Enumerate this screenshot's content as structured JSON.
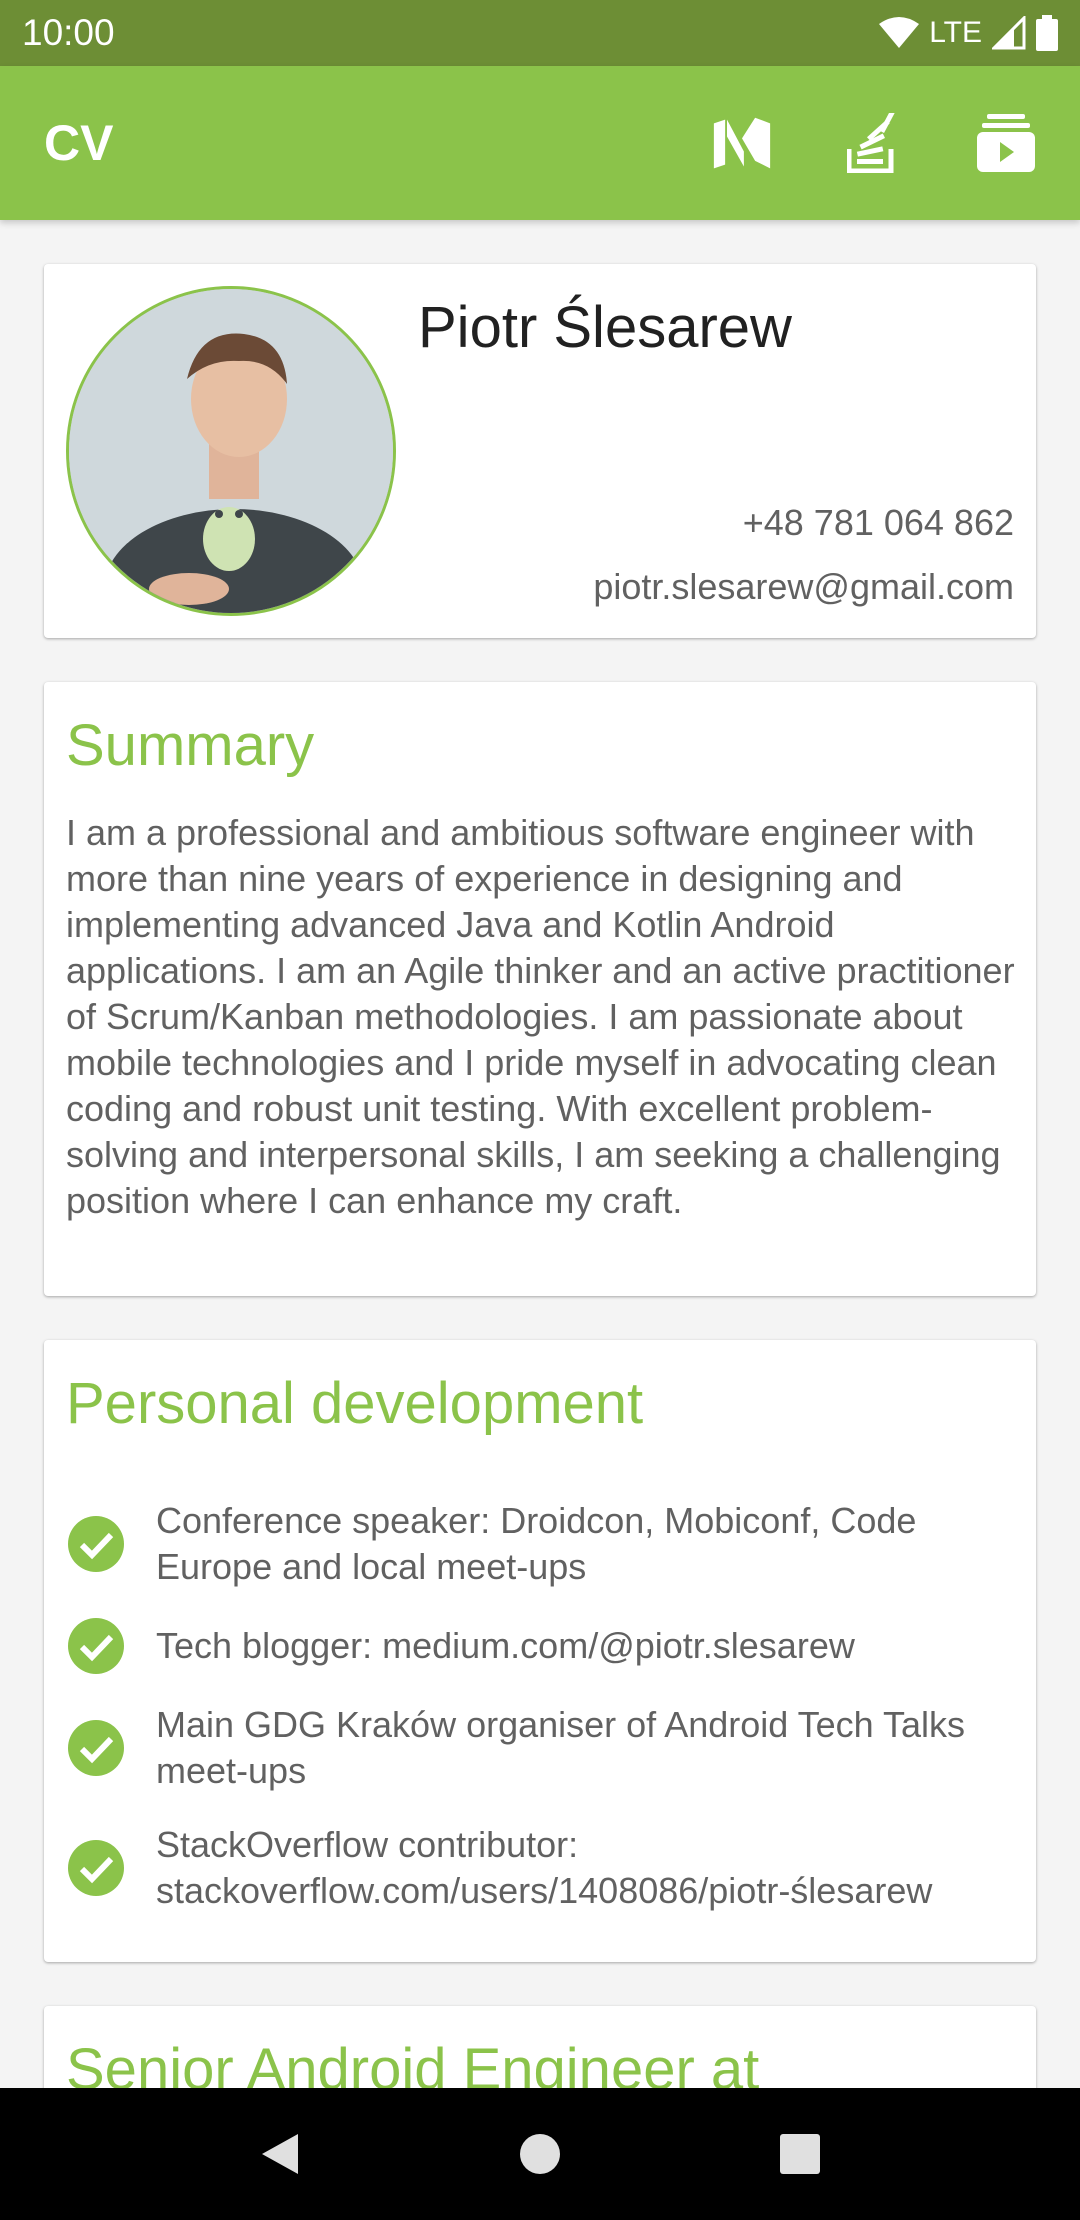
{
  "status_bar": {
    "time": "10:00",
    "network": "LTE"
  },
  "app_bar": {
    "title": "CV",
    "actions": [
      "medium-icon",
      "stackoverflow-icon",
      "youtube-icon"
    ]
  },
  "profile": {
    "name": "Piotr Ślesarew",
    "phone": "+48 781 064 862",
    "email": "piotr.slesarew@gmail.com"
  },
  "summary": {
    "heading": "Summary",
    "text": "I am a professional and ambitious software engineer with more than nine years of experience in designing and implementing advanced Java and Kotlin Android applications. I am an Agile thinker and an active practitioner of Scrum/Kanban methodologies. I am passionate about mobile technologies and I pride myself in advocating clean coding and robust unit testing. With excellent problem-solving and interpersonal skills, I am seeking a challenging position where I can enhance my craft."
  },
  "personal_development": {
    "heading": "Personal development",
    "items": [
      "Conference speaker: Droidcon, Mobiconf, Code Europe and local meet-ups",
      "Tech blogger: medium.com/@piotr.slesarew",
      "Main GDG Kraków organiser of Android Tech Talks meet-ups",
      "StackOverflow contributor: stackoverflow.com/users/1408086/piotr-ślesarew"
    ]
  },
  "next_section": {
    "heading": "Senior Android Engineer at"
  },
  "colors": {
    "accent": "#8bc34a",
    "status_bar": "#6d8e35",
    "text": "#616161"
  }
}
